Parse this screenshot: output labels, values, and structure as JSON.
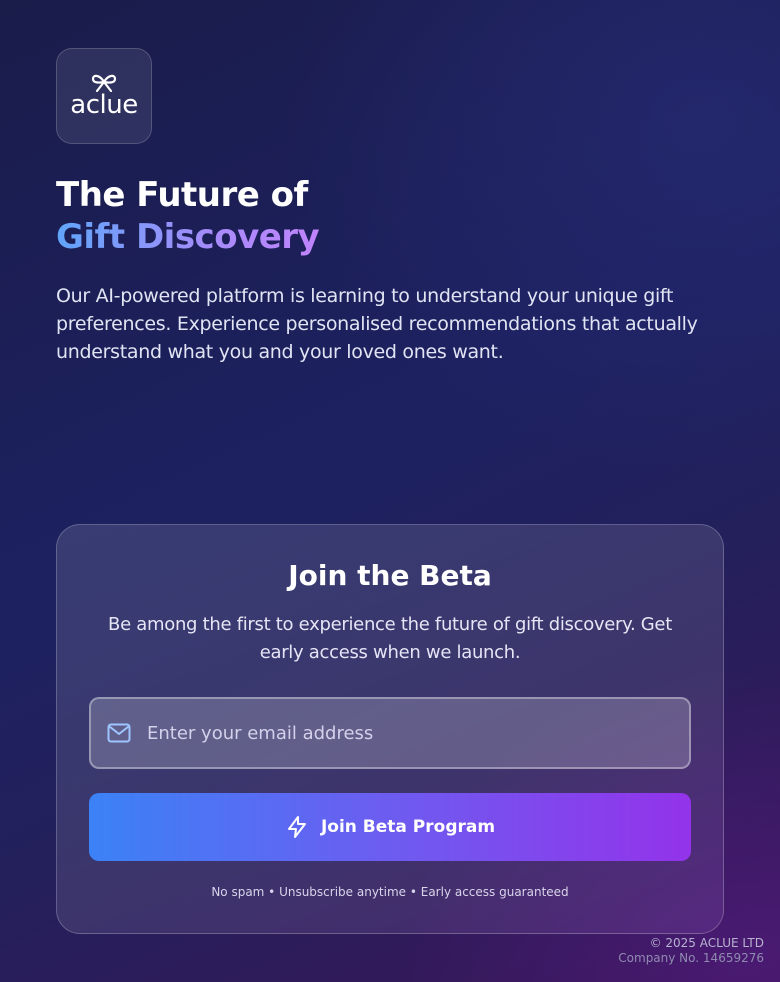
{
  "brand": {
    "logo_text": "aclue",
    "logo_icon": "gift-bow-icon"
  },
  "hero": {
    "title_line1": "The Future of",
    "title_line2": "Gift Discovery",
    "description": "Our AI-powered platform is learning to understand your unique gift preferences. Experience personalised recommendations that actually understand what you and your loved ones want."
  },
  "signup": {
    "title": "Join the Beta",
    "description": "Be among the first to experience the future of gift discovery. Get early access when we launch.",
    "email_placeholder": "Enter your email address",
    "email_value": "",
    "email_icon": "mail-icon",
    "button_label": "Join Beta Program",
    "button_icon": "lightning-icon",
    "fine_print": "No spam • Unsubscribe anytime • Early access guaranteed"
  },
  "footer": {
    "copyright": "© 2025 ACLUE LTD",
    "company_no": "Company No. 14659276"
  },
  "colors": {
    "gradient_start": "#3b82f6",
    "gradient_end": "#9333ea",
    "title_gradient_start": "#60a5fa",
    "title_gradient_end": "#c084fc"
  }
}
